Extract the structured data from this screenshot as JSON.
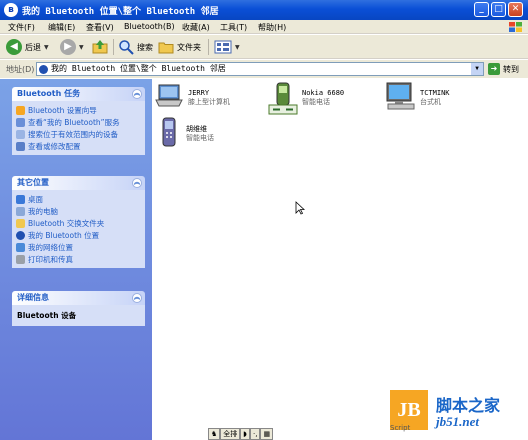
{
  "window": {
    "title": "我的 Bluetooth 位置\\整个 Bluetooth 邻居"
  },
  "menu": {
    "items": [
      "文件(F)",
      "编辑(E)",
      "查看(V)",
      "Bluetooth(B)",
      "收藏(A)",
      "工具(T)",
      "帮助(H)"
    ]
  },
  "toolbar": {
    "back_label": "后退",
    "search_label": "搜索",
    "folders_label": "文件夹"
  },
  "address": {
    "label": "地址(D)",
    "value": "我的 Bluetooth 位置\\整个 Bluetooth 邻居",
    "go_label": "转到"
  },
  "sidebar": {
    "bt_tasks": {
      "title": "Bluetooth 任务",
      "items": [
        "Bluetooth 设置向导",
        "查看“我的 Bluetooth”服务",
        "搜索位于有效范围内的设备",
        "查看或修改配置"
      ]
    },
    "other_places": {
      "title": "其它位置",
      "items": [
        "桌面",
        "我的电脑",
        "Bluetooth 交换文件夹",
        "我的 Bluetooth 位置",
        "我的网络位置",
        "打印机和传真"
      ]
    },
    "details": {
      "title": "详细信息",
      "text": "Bluetooth 设备"
    }
  },
  "devices": [
    {
      "name": "JERRY",
      "type": "膝上型计算机",
      "icon": "laptop-icon"
    },
    {
      "name": "Nokia 6680",
      "type": "智能电话",
      "icon": "phone-icon"
    },
    {
      "name": "TCTMINK",
      "type": "台式机",
      "icon": "desktop-icon"
    },
    {
      "name": "胡维维",
      "type": "智能电话",
      "icon": "phone-icon"
    }
  ],
  "taskbar_fragment": {
    "label": "全排"
  },
  "watermark": {
    "logo_text": "JB",
    "script_text": "Script",
    "cn_text": "脚本之家",
    "url_text": "jb51.net"
  },
  "colors": {
    "title_blue": "#0a4fd6",
    "sidebar_blue": "#7ba2e7",
    "link_blue": "#215dc6",
    "panel_bg": "#d6dff7"
  }
}
